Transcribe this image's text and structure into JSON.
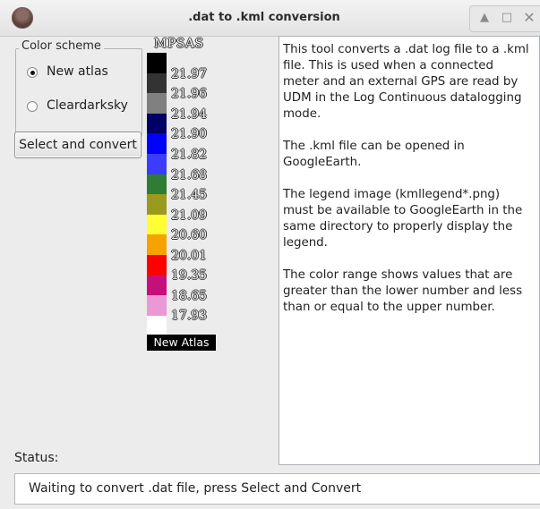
{
  "window": {
    "title": ".dat to .kml conversion",
    "controls": {
      "up": "▲",
      "maximize": "□",
      "close": "✕"
    }
  },
  "color_scheme": {
    "title": "Color scheme",
    "options": [
      {
        "label": "New atlas",
        "selected": true
      },
      {
        "label": "Cleardarksky",
        "selected": false
      }
    ]
  },
  "button": {
    "label": "Select and convert"
  },
  "legend": {
    "title": "MPSAS",
    "caption": "New Atlas",
    "values": [
      "21.97",
      "21.96",
      "21.94",
      "21.90",
      "21.82",
      "21.68",
      "21.45",
      "21.09",
      "20.60",
      "20.01",
      "19.35",
      "18.65",
      "17.93"
    ],
    "colors": [
      "#000000",
      "#333333",
      "#808080",
      "#000066",
      "#0000ff",
      "#3c3cff",
      "#2e7d32",
      "#999a1e",
      "#ffff33",
      "#f6a300",
      "#ff0000",
      "#c70f7b",
      "#ea98d6",
      "#ffffff"
    ]
  },
  "info": {
    "paragraphs": [
      "This tool converts a .dat log file to a .kml file. This is used when a connected meter and an external GPS are read by UDM in the Log Continuous datalogging mode.",
      "The .kml file can be opened in GoogleEarth.",
      "The legend image (kmllegend*.png) must be available to GoogleEarth in the same directory to properly display the legend.",
      "The color range shows values that are greater than the lower number and less than or equal to the upper number."
    ]
  },
  "status": {
    "label": "Status:",
    "text": "Waiting to convert .dat file, press Select and Convert"
  }
}
